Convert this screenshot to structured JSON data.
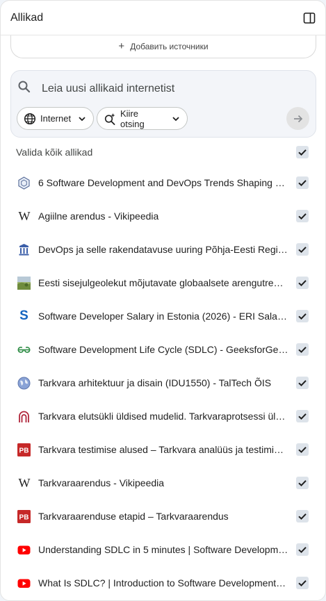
{
  "header": {
    "title": "Allikad"
  },
  "add_source": {
    "label": "Добавить источники"
  },
  "search": {
    "placeholder": "Leia uusi allikaid internetist",
    "chip_internet": "Internet",
    "chip_fast": "Kiire otsing"
  },
  "select_all": {
    "label": "Valida kõik allikad",
    "checked": true
  },
  "sources": [
    {
      "title": "6 Software Development and DevOps Trends Shaping 2…",
      "icon": "hexagon-icon",
      "checked": true
    },
    {
      "title": "Agiilne arendus - Vikipeedia",
      "icon": "wikipedia-icon",
      "checked": true
    },
    {
      "title": "DevOps ja selle rakendatavuse uuring Põhja-Eesti Regi…",
      "icon": "institution-crest-icon",
      "checked": true
    },
    {
      "title": "Eesti sisejulgeolekut mõjutavate globaalsete arengutre…",
      "icon": "landscape-thumbnail-icon",
      "checked": true
    },
    {
      "title": "Software Developer Salary in Estonia (2026) - ERI Salar…",
      "icon": "eri-s-icon",
      "checked": true
    },
    {
      "title": "Software Development Life Cycle (SDLC) - GeeksforGe…",
      "icon": "geeksforgeeks-icon",
      "checked": true
    },
    {
      "title": "Tarkvara arhitektuur ja disain (IDU1550) - TalTech ÕIS",
      "icon": "globe-icon",
      "checked": true
    },
    {
      "title": "Tarkvara elutsükli üldised mudelid. Tarkvaraprotsessi ül…",
      "icon": "arch-logo-icon",
      "checked": true
    },
    {
      "title": "Tarkvara testimise alused – Tarkvara analüüs ja testimi…",
      "icon": "pb-icon",
      "checked": true
    },
    {
      "title": "Tarkvaraarendus - Vikipeedia",
      "icon": "wikipedia-icon",
      "checked": true
    },
    {
      "title": "Tarkvaraarenduse etapid – Tarkvaraarendus",
      "icon": "pb-icon",
      "checked": true
    },
    {
      "title": "Understanding SDLC in 5 minutes | Software Developm…",
      "icon": "youtube-icon",
      "checked": true
    },
    {
      "title": "What Is SDLC? | Introduction to Software Development …",
      "icon": "youtube-icon",
      "checked": true
    }
  ],
  "colors": {
    "accent": "#1f1f1f",
    "checkbox_bg": "#dde3ea",
    "pb_red": "#c62828",
    "youtube_red": "#ff0000",
    "gfg_green": "#2f8d46",
    "eri_blue": "#1565c0",
    "arch_red": "#b0253a"
  }
}
